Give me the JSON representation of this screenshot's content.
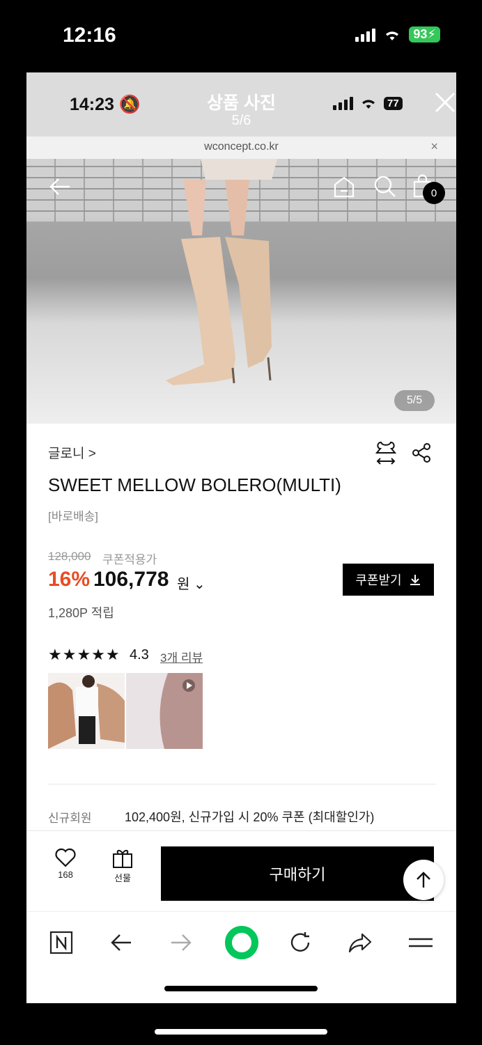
{
  "outer_status": {
    "time": "12:16",
    "battery": "93"
  },
  "inner_status": {
    "time": "14:23",
    "battery": "77"
  },
  "viewer": {
    "title": "상품 사진",
    "counter": "5/6"
  },
  "url_bar": {
    "url": "wconcept.co.kr",
    "close": "×"
  },
  "photo": {
    "cart_count": "0",
    "counter": "5/5"
  },
  "product": {
    "brand": "글로니 >",
    "title": "SWEET MELLOW BOLERO(MULTI)",
    "shipping": "[바로배송]",
    "original_price": "128,000",
    "coupon_price_label": "쿠폰적용가",
    "discount": "16%",
    "price": "106,778",
    "currency": "원",
    "price_toggle": "⌄",
    "points": "1,280P 적립",
    "coupon_button": "쿠폰받기",
    "stars": "★★★★★",
    "rating": "4.3",
    "rating_value": 4.3,
    "review_link": "3개 리뷰",
    "member_label": "신규회원",
    "member_text": "102,400원, 신규가입 시 20% 쿠폰 (최대할인가)"
  },
  "actions": {
    "like_count": "168",
    "gift_label": "선물",
    "buy_label": "구매하기"
  },
  "colors": {
    "accent_discount": "#e84d24",
    "naver_green": "#03c75a",
    "battery_green": "#34c759"
  }
}
